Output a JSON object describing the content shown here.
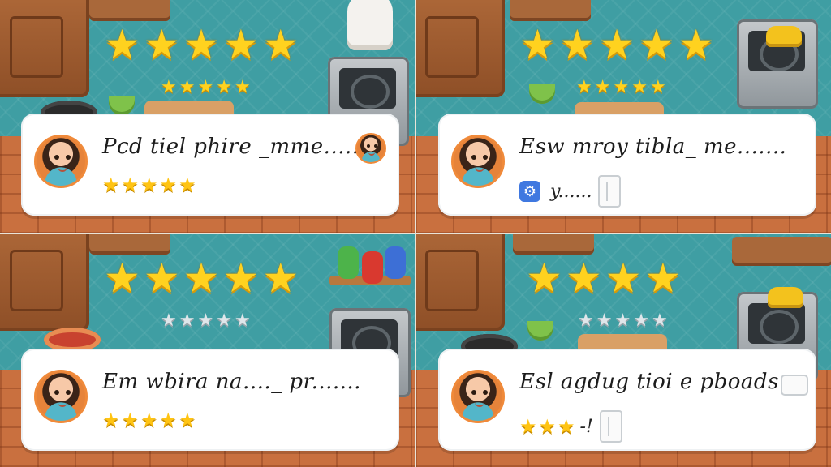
{
  "panels": [
    {
      "id": "panel-1",
      "big_stars": 5,
      "small_stars_filled": 5,
      "small_stars_total": 5,
      "review": {
        "text": "Pcd tiel phire _mme......",
        "stars_filled": 5,
        "extra_text": "",
        "has_mini_avatar": true
      }
    },
    {
      "id": "panel-2",
      "big_stars": 5,
      "small_stars_filled": 5,
      "small_stars_total": 5,
      "review": {
        "text": "Esw mroy tibla_ me.......",
        "stars_filled": 0,
        "extra_text": "y......",
        "has_gear_badge": true,
        "has_doc_icon": true
      }
    },
    {
      "id": "panel-3",
      "big_stars": 5,
      "small_stars_filled": 0,
      "small_stars_total": 5,
      "review": {
        "text": "Em wbira na...._ pr.......",
        "stars_filled": 5,
        "extra_text": ""
      }
    },
    {
      "id": "panel-4",
      "big_stars": 4,
      "small_stars_filled": 0,
      "small_stars_total": 5,
      "review": {
        "text": "Esl agdug tioi e pboads...",
        "stars_filled": 3,
        "extra_text": "-!",
        "has_doc_icon": true,
        "has_chip_icon": true
      }
    }
  ],
  "colors": {
    "star_gold": "#ffd21f",
    "star_empty": "#dfe6ea",
    "tile_teal": "#3f9ea3",
    "floor_brick": "#c9703f",
    "card_bg": "#ffffff"
  },
  "icons": {
    "big_star": "★",
    "small_star": "★",
    "gear": "⚙"
  }
}
